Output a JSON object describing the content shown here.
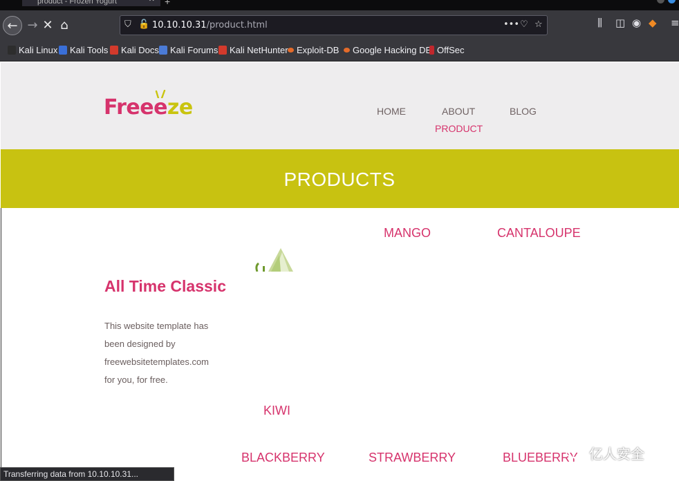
{
  "browser": {
    "tab_title": "product - Frozen Yogurt",
    "url_host": "10.10.10.31",
    "url_path": "/product.html",
    "bookmarks": [
      {
        "label": "Kali Linux",
        "color": "#2d2d2d"
      },
      {
        "label": "Kali Tools",
        "color": "#3a6fd8"
      },
      {
        "label": "Kali Docs",
        "color": "#d33a2c"
      },
      {
        "label": "Kali Forums",
        "color": "#4b7bd6"
      },
      {
        "label": "Kali NetHunter",
        "color": "#d33a2c"
      },
      {
        "label": "Exploit-DB",
        "color": "#e46b2a"
      },
      {
        "label": "Google Hacking DB",
        "color": "#e46b2a"
      },
      {
        "label": "OffSec",
        "color": "#c0282d"
      }
    ],
    "status_text": "Transferring data from 10.10.10.31..."
  },
  "site": {
    "logo_part1": "Freee",
    "logo_part2": "ze",
    "nav": {
      "home": "HOME",
      "about": "ABOUT",
      "blog": "BLOG",
      "product": "PRODUCT"
    },
    "banner_title": "PRODUCTS",
    "products": {
      "mango": "MANGO",
      "cantaloupe": "CANTALOUPE",
      "kiwi": "KIWI",
      "blackberry": "BLACKBERRY",
      "strawberry": "STRAWBERRY",
      "blueberry": "BLUEBERRY"
    },
    "classic_title": "All Time Classic",
    "classic_text": "This website template has been designed by freewebsitetemplates.com for you, for free."
  },
  "watermark": "亿人安全",
  "colors": {
    "brand_pink": "#d6336c",
    "brand_yellow": "#c8c211"
  }
}
